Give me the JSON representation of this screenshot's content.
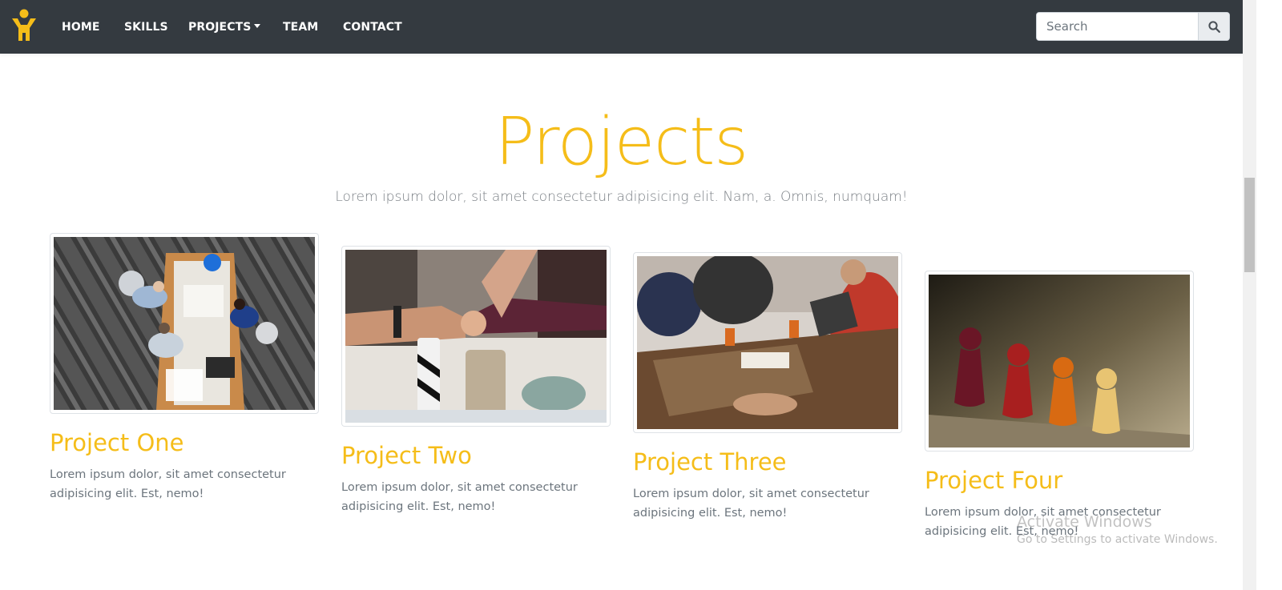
{
  "nav": {
    "items": [
      {
        "label": "HOME"
      },
      {
        "label": "SKILLS"
      },
      {
        "label": "PROJECTS"
      },
      {
        "label": "TEAM"
      },
      {
        "label": "CONTACT"
      }
    ],
    "search_placeholder": "Search",
    "logo_icon": "person-arms-up-icon",
    "logo_color": "#f5bd19",
    "search_icon": "search-icon"
  },
  "section": {
    "title": "Projects",
    "subtitle": "Lorem ipsum dolor, sit amet consectetur adipisicing elit. Nam, a. Omnis, numquam!"
  },
  "projects": [
    {
      "title": "Project One",
      "text": "Lorem ipsum dolor, sit amet consectetur adipisicing elit. Est, nemo!",
      "image": "team-meeting-overhead-photo"
    },
    {
      "title": "Project Two",
      "text": "Lorem ipsum dolor, sit amet consectetur adipisicing elit. Est, nemo!",
      "image": "fist-bump-photo"
    },
    {
      "title": "Project Three",
      "text": "Lorem ipsum dolor, sit amet consectetur adipisicing elit. Est, nemo!",
      "image": "people-working-table-photo"
    },
    {
      "title": "Project Four",
      "text": "Lorem ipsum dolor, sit amet consectetur adipisicing elit. Est, nemo!",
      "image": "wooden-pawns-photo"
    }
  ],
  "watermark": {
    "line1": "Activate Windows",
    "line2": "Go to Settings to activate Windows."
  },
  "colors": {
    "accent": "#f5bd19",
    "navbar": "#343a40",
    "text_muted": "#6c757d"
  }
}
